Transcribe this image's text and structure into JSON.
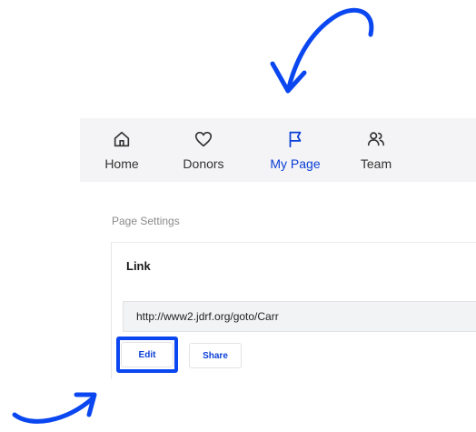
{
  "nav": {
    "tabs": [
      {
        "label": "Home",
        "icon": "home-icon",
        "active": false
      },
      {
        "label": "Donors",
        "icon": "heart-icon",
        "active": false
      },
      {
        "label": "My Page",
        "icon": "flag-icon",
        "active": true
      },
      {
        "label": "Team",
        "icon": "users-icon",
        "active": false
      }
    ]
  },
  "page_settings": {
    "section_label": "Page Settings",
    "card_title": "Link",
    "link_value": "http://www2.jdrf.org/goto/Carr",
    "edit_label": "Edit",
    "share_label": "Share"
  },
  "colors": {
    "accent": "#0a3fd6",
    "annotation": "#0a47f0",
    "tabbar_bg": "#f4f4f6"
  }
}
